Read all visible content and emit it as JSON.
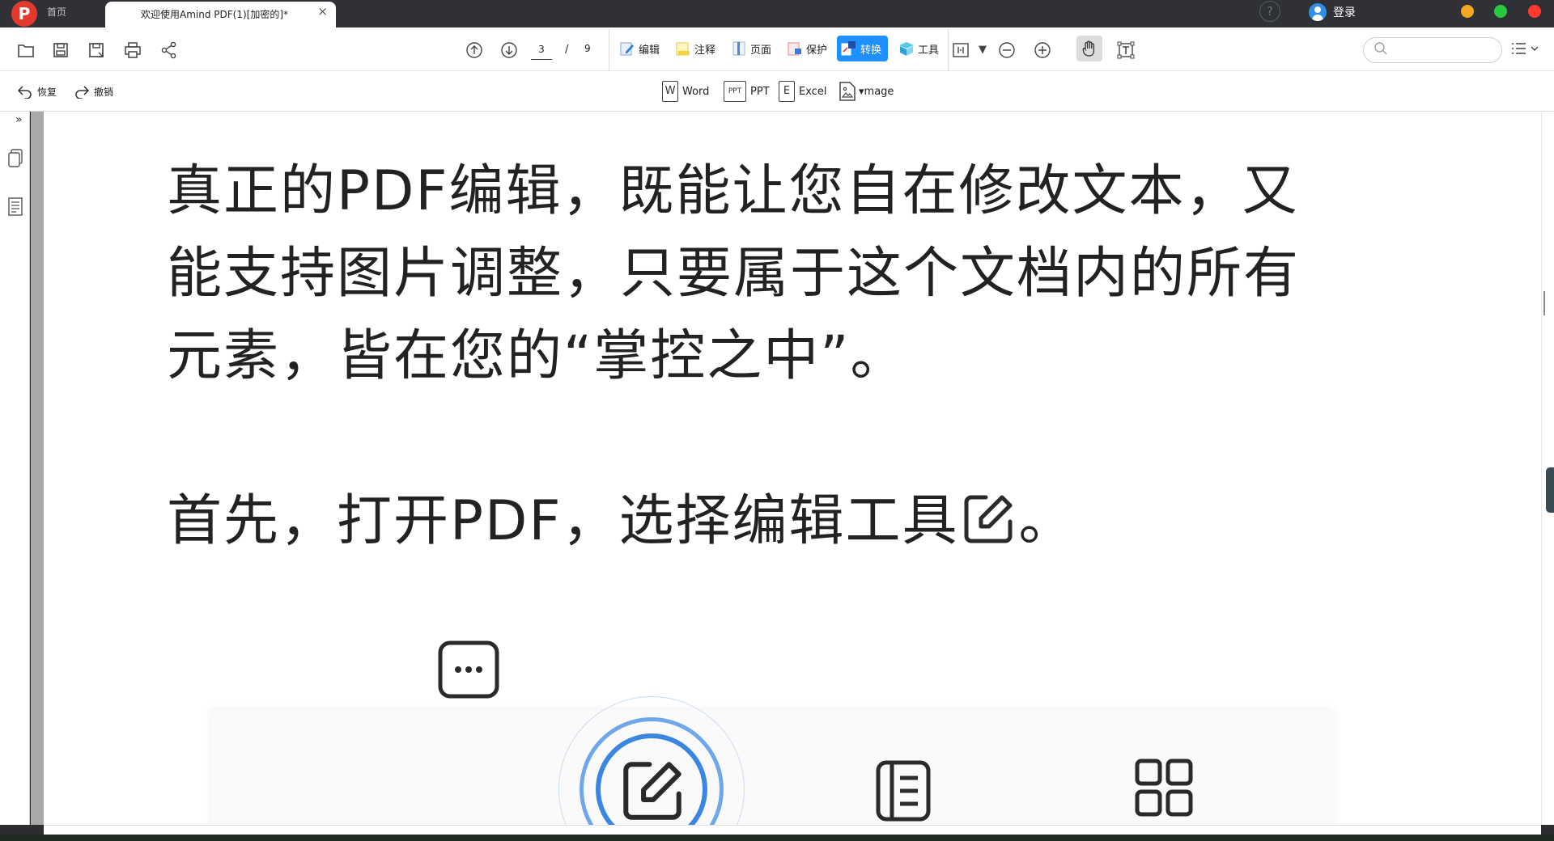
{
  "titlebar": {
    "logo_letter": "P",
    "tab_home": "首页",
    "tab_doc": "欢迎使用Amind PDF(1)[加密的]*",
    "tab_close": "×",
    "help": "?",
    "login": "登录",
    "window_dots": [
      "#f5a623",
      "#28c840",
      "#ff3b30"
    ]
  },
  "toolbar": {
    "current_page": "3",
    "page_sep": "/",
    "total_pages": "9",
    "tools": [
      {
        "label": "编辑",
        "icon": "edit-icon"
      },
      {
        "label": "注释",
        "icon": "annotate-icon"
      },
      {
        "label": "页面",
        "icon": "page-icon"
      },
      {
        "label": "保护",
        "icon": "protect-icon"
      },
      {
        "label": "转换",
        "icon": "convert-icon",
        "active": true
      },
      {
        "label": "工具",
        "icon": "tools-icon"
      }
    ],
    "search_placeholder": "",
    "accent": "#1e90ff"
  },
  "subbar": {
    "undo": "恢复",
    "redo": "撤销",
    "formats": [
      "Word",
      "PPT",
      "Excel",
      "▾mage"
    ]
  },
  "document": {
    "paragraph1": [
      "真正的PDF编辑，既能让您自在修改文本，又",
      "能支持图片调整，只要属于这个文档内的所有",
      "元素，皆在您的“掌控之中”。"
    ],
    "paragraph2_before": "首先，打开PDF，选择编辑工具",
    "paragraph2_after": "。"
  }
}
